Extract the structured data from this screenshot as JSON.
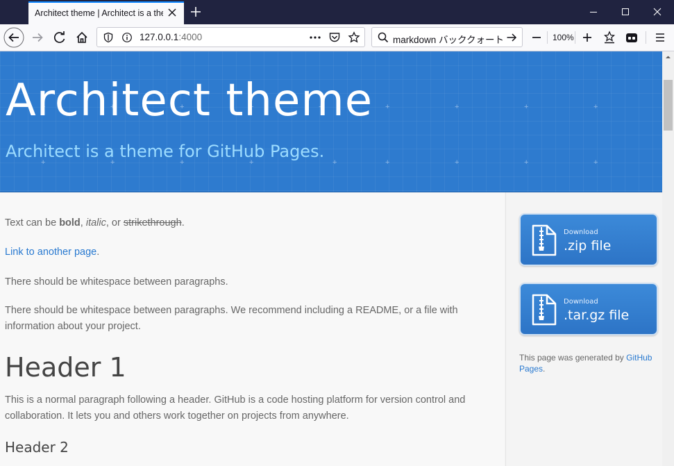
{
  "browser": {
    "tab_title": "Architect theme | Architect is a theme for GitHub Pages.",
    "url_host": "127.0.0.1",
    "url_port": ":4000",
    "search_text": "markdown バッククォート エン",
    "zoom": "100%"
  },
  "header": {
    "title": "Architect theme",
    "subtitle": "Architect is a theme for GitHub Pages."
  },
  "content": {
    "p1_prefix": "Text can be ",
    "p1_bold": "bold",
    "p1_sep1": ", ",
    "p1_italic": "italic",
    "p1_sep2": ", or ",
    "p1_strike": "strikethrough",
    "p1_end": ".",
    "link_text": "Link to another page",
    "link_end": ".",
    "p3": "There should be whitespace between paragraphs.",
    "p4": "There should be whitespace between paragraphs. We recommend including a README, or a file with information about your project.",
    "h1": "Header 1",
    "p5": "This is a normal paragraph following a header. GitHub is a code hosting platform for version control and collaboration. It lets you and others work together on projects from anywhere.",
    "h2": "Header 2"
  },
  "sidebar": {
    "zip_small": "Download",
    "zip_big": ".zip file",
    "tar_small": "Download",
    "tar_big": ".tar.gz file",
    "generated_prefix": "This page was generated by ",
    "generated_link": "GitHub Pages",
    "generated_end": "."
  },
  "colors": {
    "header_bg": "#2e7bcf",
    "subtitle": "#9ddcff",
    "link": "#2879d0",
    "button": "#3b86d6"
  }
}
